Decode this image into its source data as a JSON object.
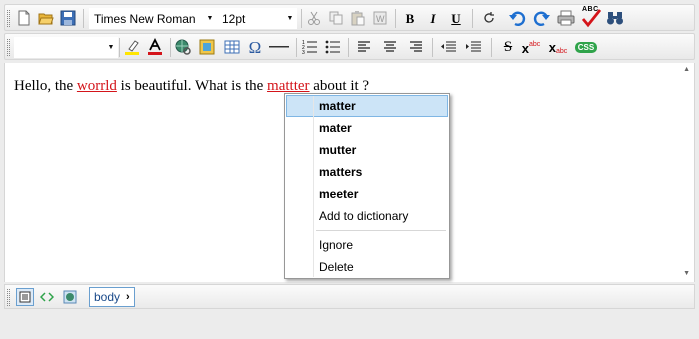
{
  "toolbar1": {
    "font_family": "Times New Roman",
    "font_size": "12pt",
    "bold_label": "B",
    "italic_label": "I",
    "underline_label": "U",
    "spellcheck_label": "ABC"
  },
  "toolbar2": {
    "style_value": "",
    "omega_label": "Ω",
    "css_label": "CSS",
    "superscript_label": "abc",
    "subscript_label": "abc"
  },
  "editor": {
    "text_parts": [
      "Hello, the ",
      "worrld",
      " is beautiful. What is the ",
      "mattter",
      " about it ?"
    ]
  },
  "context_menu": {
    "suggestions": [
      "matter",
      "mater",
      "mutter",
      "matters",
      "meeter"
    ],
    "add_to_dictionary": "Add to dictionary",
    "ignore": "Ignore",
    "delete": "Delete"
  },
  "statusbar": {
    "breadcrumb": "body",
    "breadcrumb_chevron": "›"
  },
  "colors": {
    "misspelled": "#d4141a",
    "highlight": "#cce4f7",
    "accent_blue": "#1e6fd0"
  }
}
